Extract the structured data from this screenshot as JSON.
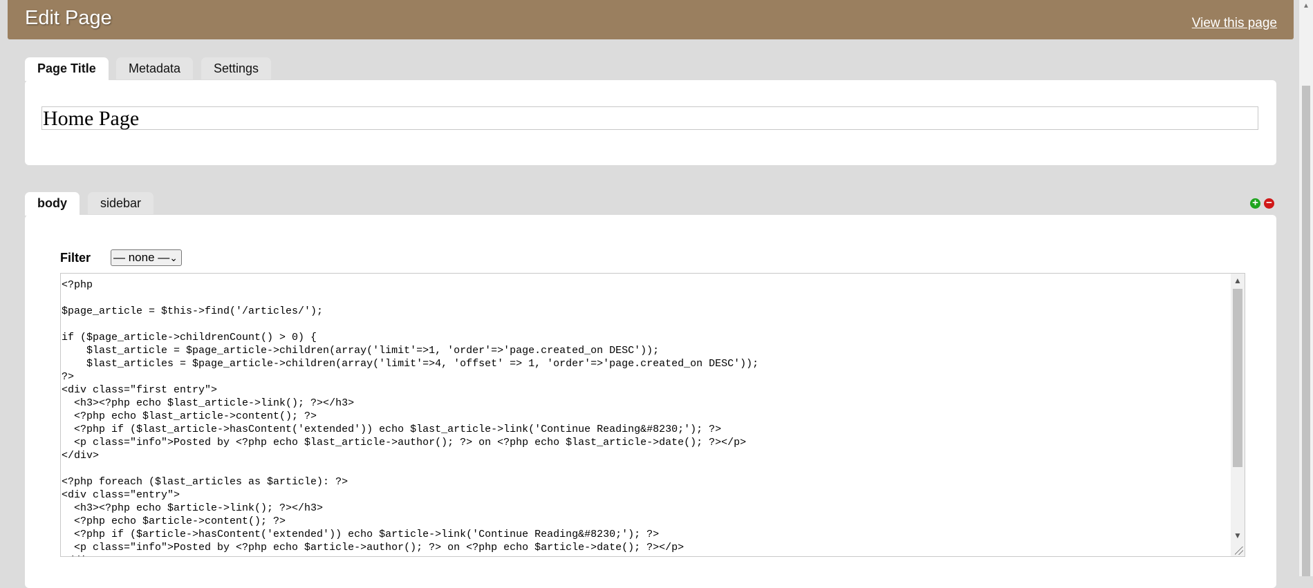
{
  "header": {
    "title": "Edit Page",
    "view_link": "View this page"
  },
  "title_tabs": [
    {
      "label": "Page Title",
      "active": true
    },
    {
      "label": "Metadata",
      "active": false
    },
    {
      "label": "Settings",
      "active": false
    }
  ],
  "page_title_value": "Home Page",
  "part_tabs": [
    {
      "label": "body",
      "active": true
    },
    {
      "label": "sidebar",
      "active": false
    }
  ],
  "icons": {
    "add": "plus-circle-icon",
    "remove": "minus-circle-icon",
    "add_color": "#1fa51f",
    "remove_color": "#d01818"
  },
  "filter": {
    "label": "Filter",
    "selected": "— none —"
  },
  "code": "<?php\n\n$page_article = $this->find('/articles/');\n\nif ($page_article->childrenCount() > 0) {\n    $last_article = $page_article->children(array('limit'=>1, 'order'=>'page.created_on DESC'));\n    $last_articles = $page_article->children(array('limit'=>4, 'offset' => 1, 'order'=>'page.created_on DESC'));\n?>\n<div class=\"first entry\">\n  <h3><?php echo $last_article->link(); ?></h3>\n  <?php echo $last_article->content(); ?>\n  <?php if ($last_article->hasContent('extended')) echo $last_article->link('Continue Reading&#8230;'); ?>\n  <p class=\"info\">Posted by <?php echo $last_article->author(); ?> on <?php echo $last_article->date(); ?></p>\n</div>\n\n<?php foreach ($last_articles as $article): ?>\n<div class=\"entry\">\n  <h3><?php echo $article->link(); ?></h3>\n  <?php echo $article->content(); ?>\n  <?php if ($article->hasContent('extended')) echo $article->link('Continue Reading&#8230;'); ?>\n  <p class=\"info\">Posted by <?php echo $article->author(); ?> on <?php echo $article->date(); ?></p>\n</div>",
  "colors": {
    "header": "#9a7f5f",
    "background": "#dcdcdc",
    "tab_inactive": "#e4e4e4"
  }
}
